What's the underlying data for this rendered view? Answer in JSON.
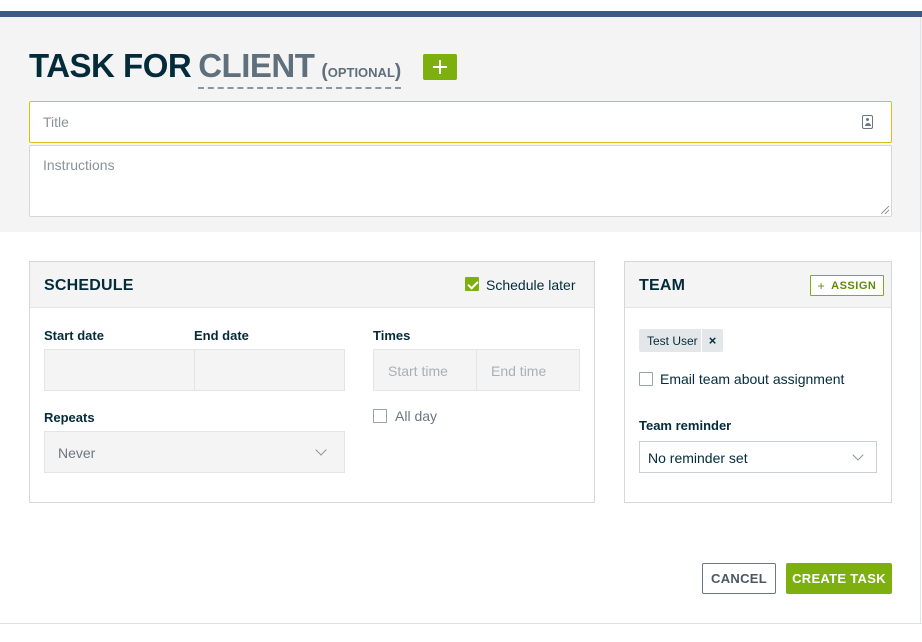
{
  "header": {
    "task_for": "TASK FOR",
    "client": "CLIENT",
    "optional": "(OPTIONAL)"
  },
  "form": {
    "title_placeholder": "Title",
    "instructions_placeholder": "Instructions"
  },
  "schedule": {
    "heading": "SCHEDULE",
    "schedule_later_label": "Schedule later",
    "schedule_later_checked": true,
    "start_date_label": "Start date",
    "end_date_label": "End date",
    "times_label": "Times",
    "start_time_placeholder": "Start time",
    "end_time_placeholder": "End time",
    "repeats_label": "Repeats",
    "repeats_value": "Never",
    "all_day_label": "All day"
  },
  "team": {
    "heading": "TEAM",
    "assign_label": "ASSIGN",
    "assigned_user": "Test User",
    "email_label": "Email team about assignment",
    "reminder_label": "Team reminder",
    "reminder_value": "No reminder set"
  },
  "actions": {
    "cancel_label": "CANCEL",
    "create_label": "CREATE TASK"
  },
  "colors": {
    "accent_green": "#7db00e",
    "top_bar": "#3d5a80",
    "heading_dark": "#032b3a",
    "focus_border": "#d6c21a"
  }
}
